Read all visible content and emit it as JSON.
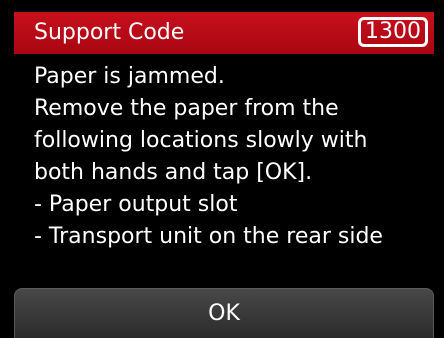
{
  "header": {
    "title": "Support Code",
    "code": "1300"
  },
  "message": {
    "lines": [
      "Paper is jammed.",
      "Remove the paper from the",
      "following locations slowly with",
      "both hands and tap [OK].",
      "- Paper output slot",
      "- Transport unit on the rear side"
    ]
  },
  "actions": {
    "ok_label": "OK"
  },
  "colors": {
    "header_bg": "#b80b18",
    "screen_bg": "#000000",
    "text": "#ffffff",
    "button_bg": "#3a3a3a"
  }
}
